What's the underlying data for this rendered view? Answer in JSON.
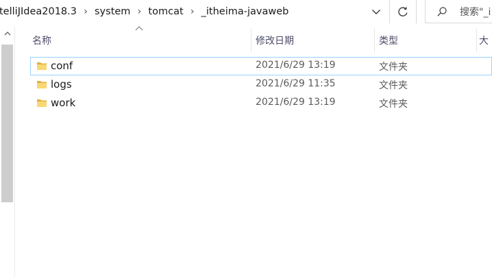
{
  "breadcrumb": {
    "items": [
      "telliJIdea2018.3",
      "system",
      "tomcat",
      "_itheima-javaweb"
    ],
    "separator": "›"
  },
  "search": {
    "placeholder": "搜索\"_i"
  },
  "columns": {
    "name": "名称",
    "modified": "修改日期",
    "type": "类型",
    "size": "大"
  },
  "files": [
    {
      "name": "conf",
      "modified": "2021/6/29 13:19",
      "type": "文件夹",
      "icon": "folder-icon"
    },
    {
      "name": "logs",
      "modified": "2021/6/29 11:35",
      "type": "文件夹",
      "icon": "folder-icon"
    },
    {
      "name": "work",
      "modified": "2021/6/29 13:19",
      "type": "文件夹",
      "icon": "folder-icon"
    }
  ],
  "colors": {
    "folder": "#f8d775",
    "focus_border": "#99d1ff",
    "scroll_thumb": "#cdcdcd"
  }
}
